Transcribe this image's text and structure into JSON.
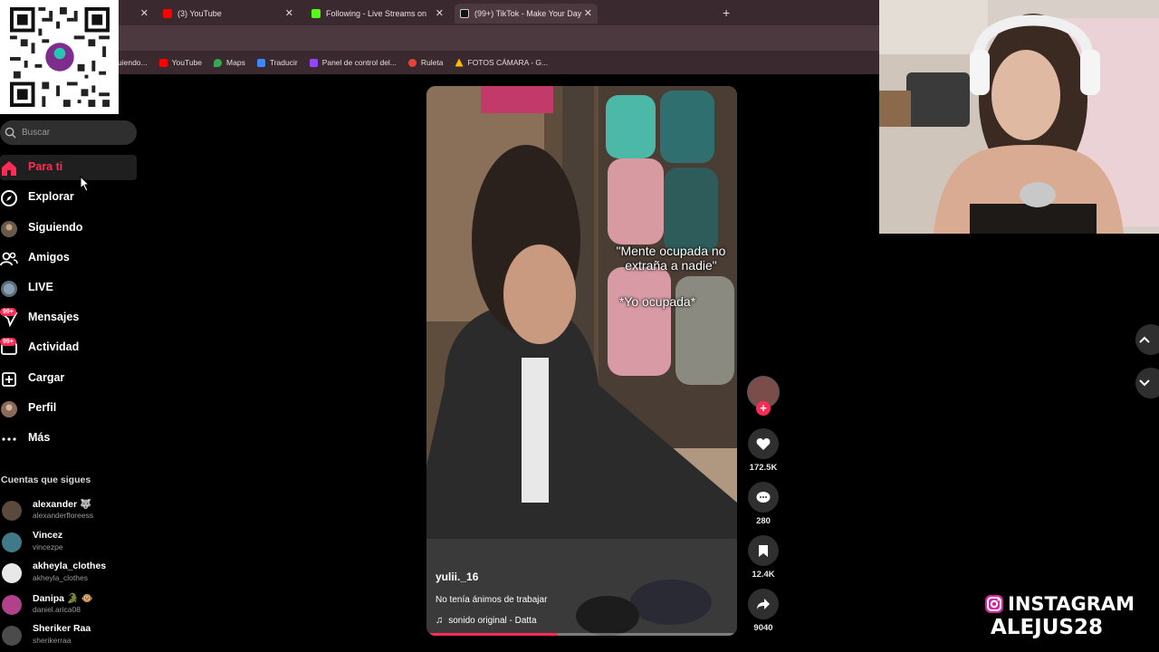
{
  "browser": {
    "tabs": [
      {
        "title": "",
        "icon": "tab-blank-icon"
      },
      {
        "title": "(3) YouTube",
        "icon": "youtube-icon",
        "color": "#ff0000"
      },
      {
        "title": "Following - Live Streams on Kick",
        "icon": "kick-icon",
        "color": "#53fc18"
      },
      {
        "title": "(99+) TikTok - Make Your Day",
        "icon": "tiktok-icon",
        "color": "#ffffff",
        "active": true
      }
    ],
    "bookmarks": [
      {
        "label": "uiendo...",
        "icon": "bookmark-icon"
      },
      {
        "label": "YouTube",
        "icon": "youtube-icon",
        "color": "#ff0000"
      },
      {
        "label": "Maps",
        "icon": "maps-icon",
        "color": "#34a853"
      },
      {
        "label": "Traducir",
        "icon": "translate-icon",
        "color": "#4285f4"
      },
      {
        "label": "Panel de control del...",
        "icon": "panel-icon",
        "color": "#9146ff"
      },
      {
        "label": "Ruleta",
        "icon": "ruleta-icon",
        "color": "#ea4335"
      },
      {
        "label": "FOTOS CÁMARA - G...",
        "icon": "drive-icon",
        "color": "#fbbc04"
      }
    ]
  },
  "qr": {
    "brand": "yape"
  },
  "sidebar": {
    "search_placeholder": "Buscar",
    "nav": [
      {
        "label": "Para ti",
        "icon": "home-icon",
        "active": true
      },
      {
        "label": "Explorar",
        "icon": "compass-icon"
      },
      {
        "label": "Siguiendo",
        "icon": "following-avatar-icon"
      },
      {
        "label": "Amigos",
        "icon": "friends-icon"
      },
      {
        "label": "LIVE",
        "icon": "live-icon"
      },
      {
        "label": "Mensajes",
        "icon": "messages-icon",
        "badge": "99+"
      },
      {
        "label": "Actividad",
        "icon": "activity-icon",
        "badge": "99+"
      },
      {
        "label": "Cargar",
        "icon": "upload-icon"
      },
      {
        "label": "Perfil",
        "icon": "profile-icon"
      },
      {
        "label": "Más",
        "icon": "more-icon"
      }
    ],
    "following_title": "Cuentas que sigues",
    "accounts": [
      {
        "name": "alexander 🐺",
        "handle": "alexanderfloreess",
        "color": "#5a4a3e"
      },
      {
        "name": "Vincez",
        "handle": "vincezpe",
        "color": "#3f7a8a"
      },
      {
        "name": "akheyla_clothes",
        "handle": "akheyla_clothes",
        "color": "#e8e8e8"
      },
      {
        "name": "Danipa 🐊 🐵",
        "handle": "daniel.arica08",
        "color": "#b0418a"
      },
      {
        "name": "Sheriker Raa",
        "handle": "sherikerraa",
        "color": "#4b4b4b"
      }
    ]
  },
  "video": {
    "overlay_line1": "\"Mente ocupada no",
    "overlay_line2": "extraña a nadie\"",
    "overlay_line3": "*Yo ocupada*",
    "username": "yulii._16",
    "description": "No tenía ánimos de trabajar",
    "sound": "sonido original - Datta",
    "progress": 0.42
  },
  "actions": {
    "likes": "172.5K",
    "comments": "280",
    "saves": "12.4K",
    "shares": "9040"
  },
  "stream": {
    "insta_line1": "INSTAGRAM",
    "insta_line2": "ALEJUS28"
  },
  "colors": {
    "accent": "#fe2c55",
    "background": "#000000"
  }
}
